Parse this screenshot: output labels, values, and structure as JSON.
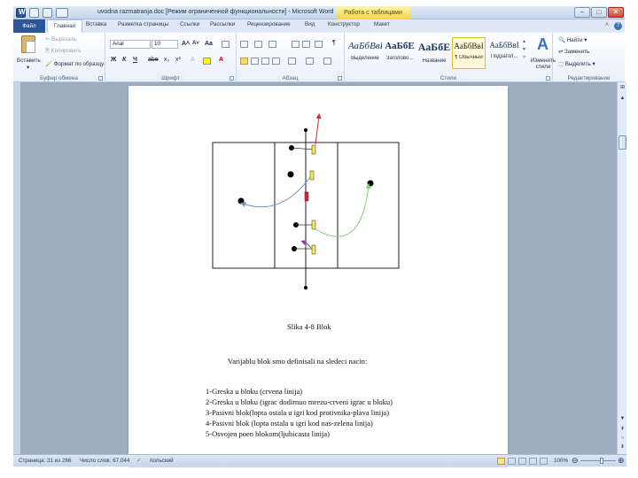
{
  "window": {
    "title": "uvodna razmatranja.doc [Режим ограниченной функциональности] - Microsoft Word",
    "context_tab": "Работа с таблицами",
    "minimize": "–",
    "maximize": "□",
    "close": "✕"
  },
  "tabs": [
    "Файл",
    "Главная",
    "Вставка",
    "Разметка страницы",
    "Ссылки",
    "Рассылки",
    "Рецензирование",
    "Вид",
    "Конструктор",
    "Макет"
  ],
  "ribbon": {
    "clipboard": {
      "paste": "Вставить",
      "cut": "Вырезать",
      "copy": "Копировать",
      "format_painter": "Формат по образцу",
      "label": "Буфер обмена"
    },
    "font": {
      "name": "Arial",
      "size": "10",
      "grow": "A˄",
      "shrink": "A˅",
      "case": "Aa",
      "bold": "Ж",
      "italic": "К",
      "underline": "Ч",
      "strike": "abe",
      "subscript": "x₂",
      "superscript": "x²",
      "label": "Шрифт"
    },
    "paragraph": {
      "label": "Абзац",
      "pilcrow": "¶"
    },
    "styles": {
      "items": [
        {
          "sample": "АаБбВвГ",
          "name": "Выделение"
        },
        {
          "sample": "АаБбЕ",
          "name": "Заголово..."
        },
        {
          "sample": "АаБбЕ",
          "name": "Название"
        },
        {
          "sample": "АаБбВвI",
          "name": "¶ Обычный"
        },
        {
          "sample": "АаБбВвI",
          "name": "Подзагол..."
        }
      ],
      "change": "Изменить стили",
      "label": "Стили"
    },
    "editing": {
      "find": "Найти",
      "replace": "Заменить",
      "select": "Выделить",
      "label": "Редактирование"
    }
  },
  "document": {
    "caption": "Slika 4-8 Blok",
    "intro": "Varijablu blok smo definisali na sledeci nacin:",
    "list": [
      "1-Greska u bloku (crvena linija)",
      "2-Greska u bloku (igrac dodirnuo mrezu-crveni  igrac u bloku)",
      "3-Pasivni blok(lopta ostala u igri kod protivnika-plava linija)",
      "4-Pasivni blok (lopta ostala u igri kod nas-zelena linija)",
      "5-Osvojen poen blokom(ljubicasta  linija)"
    ]
  },
  "colors": {
    "red": "#d9262a",
    "blue": "#6c8fc9",
    "green": "#7ccf7a",
    "purple": "#8d3fa3",
    "yellow": "#f5e84a"
  },
  "status": {
    "page": "Страница: 31 из 266",
    "words": "Число слов: 67,044",
    "lang": "польский",
    "zoom": "100%"
  }
}
